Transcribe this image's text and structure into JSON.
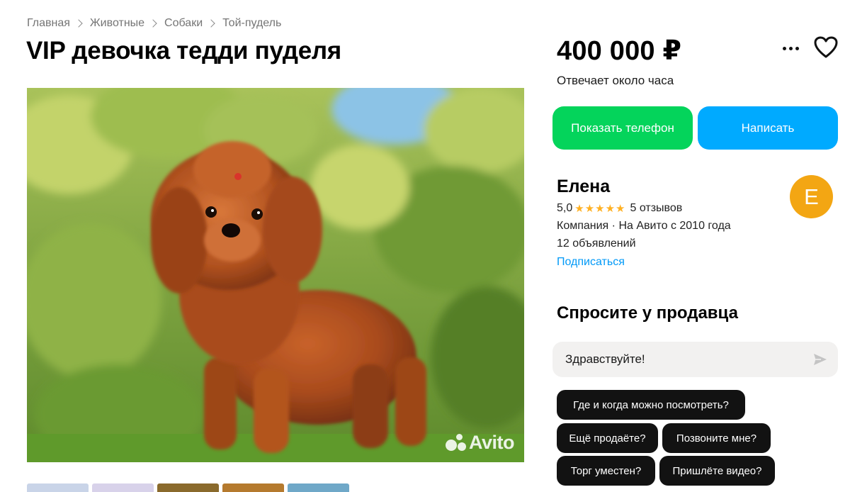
{
  "breadcrumbs": [
    "Главная",
    "Животные",
    "Собаки",
    "Той-пудель"
  ],
  "title": "VIP девочка тедди пуделя",
  "photo": {
    "alt_icon": "dog-photo",
    "watermark": "Avito"
  },
  "thumbnails": [
    "#c9d4e8",
    "#d8d2ea",
    "#8a6a2c",
    "#b57a2e",
    "#6fa8c8"
  ],
  "price": "400 000 ₽",
  "responds": "Отвечает около часа",
  "buttons": {
    "show_phone": "Показать телефон",
    "write": "Написать"
  },
  "seller": {
    "name": "Елена",
    "rating": "5,0",
    "stars": "★★★★★",
    "reviews": "5 отзывов",
    "company": "Компания · На Авито с 2010 года",
    "ads": "12 объявлений",
    "subscribe": "Подписаться",
    "avatar_letter": "Е",
    "avatar_color": "#f3a613"
  },
  "ask": {
    "title": "Спросите у продавца",
    "input_value": "Здравствуйте!",
    "chips": [
      "Где и когда можно посмотреть?",
      "Ещё продаёте?",
      "Позвоните мне?",
      "Торг уместен?",
      "Пришлёте видео?"
    ]
  },
  "colors": {
    "green_button": "#04d45b",
    "blue_button": "#00aaff",
    "link": "#0099f7",
    "stars": "#ffb021"
  },
  "icons": [
    "chevron-right-icon",
    "more-dots-icon",
    "heart-icon",
    "send-icon",
    "avito-logo"
  ]
}
